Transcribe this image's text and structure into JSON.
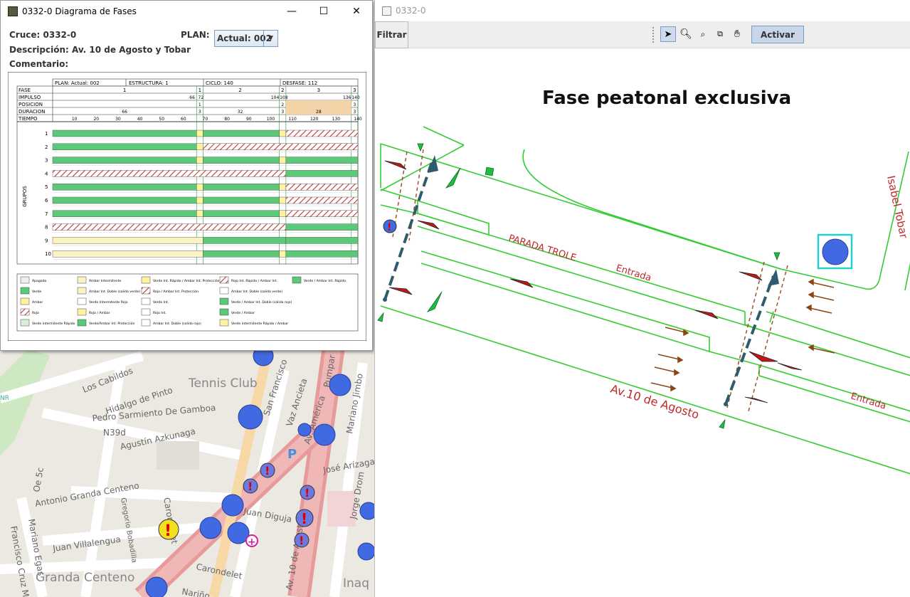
{
  "dialog": {
    "title": "0332-0  Diagrama de Fases",
    "cruce": "Cruce: 0332-0",
    "descripcion": "Descripción: Av. 10 de Agosto y Tobar",
    "comentario": "Comentario:",
    "plan_label": "PLAN:",
    "plan_value": "Actual: 002",
    "window_controls": {
      "minimize": "—",
      "maximize": "☐",
      "close": "✕"
    }
  },
  "diagram": {
    "header": [
      "PLAN: Actual: 002",
      "ESTRUCTURA: 1",
      "CICLO: 140",
      "DESFASE: 112"
    ],
    "rows": [
      "FASE",
      "IMPULSO",
      "POSICION",
      "DURACION",
      "TIEMPO"
    ],
    "fases": [
      "1",
      "1",
      "2",
      "2",
      "3",
      "3"
    ],
    "impulsos": [
      "66",
      "72",
      "104",
      "108",
      "136",
      "140"
    ],
    "posiciones": [
      "1",
      "2",
      "3",
      "1"
    ],
    "duraciones": [
      "66",
      "3",
      "32",
      "3",
      "28",
      "3"
    ],
    "tiempo_ticks": [
      "10",
      "20",
      "30",
      "40",
      "50",
      "60",
      "70",
      "80",
      "90",
      "100",
      "110",
      "120",
      "130",
      "140"
    ],
    "grupos_label": "GRUPOS",
    "grupos": [
      "1",
      "2",
      "3",
      "4",
      "5",
      "6",
      "7",
      "8",
      "9",
      "10"
    ],
    "legend": [
      "Apagado",
      "Ambar Intermitente",
      "Verde Int. Rápido / Ambar Int. Protección",
      "Rojo Int. Rápido / Ambar Int.",
      "Verde / Ambar Int. Rápido",
      "Verde",
      "Ambar Int. Doble (salida verde)",
      "Rojo / Ambar Int. Protección",
      "Ambar Int. Doble (salida verde)",
      "Ambar",
      "Verde Intermitente Rojo",
      "Verde Int.",
      "Verde / Ambar Int. Doble (salida rojo)",
      "Rojo",
      "Rojo / Ambar",
      "Rojo Int.",
      "Verde / Ambar",
      "Verde intermitente Rápido",
      "Verde/Ambar Int. Protección",
      "Ambar Int. Doble (salida rojo)",
      "Verde intermitente Rápido / Ambar"
    ]
  },
  "map": {
    "labels": [
      "Tennis Club",
      "Los Cabildos",
      "Hidalgo de Pinto",
      "Pedro Sarmiento De Gamboa",
      "N39d",
      "Agustín Azkunaga",
      "Oe 5c",
      "Antonio Granda Centeno",
      "Gregorio Bobadilla",
      "Juan Villalengua",
      "Carondelet",
      "Francisco Cruz Miranda",
      "Mariano Egas",
      "Granda Centeno",
      "San Francisco",
      "Vaz Ancieta",
      "Av. América",
      "Mariano Jimbo",
      "José Arízaga",
      "Jorge Drom",
      "Juan Diguja",
      "Carondelet",
      "Av. 10 de Agosto",
      "Inaq",
      "Nariño",
      "Av. América",
      "Pumpar",
      "P",
      "NR"
    ]
  },
  "right_window": {
    "title": "0332-0",
    "filtrar": "Filtrar",
    "activar": "Activar",
    "tools": [
      "pointer-icon",
      "zoom-icon",
      "zoom-region-icon",
      "fit-icon",
      "hand-icon"
    ],
    "heading": "Fase peatonal exclusiva",
    "street_labels": {
      "parada": "PARADA TROLE",
      "entrada1": "Entrada",
      "entrada2": "Entrada",
      "avenida": "Av.10 de Agosto",
      "isabel": "Isabel Tobar"
    }
  },
  "colors": {
    "green": "#5cc97a",
    "yellow": "#fff3a0",
    "red": "#d03030",
    "line": "#33cc33",
    "darkred": "#c02020"
  }
}
